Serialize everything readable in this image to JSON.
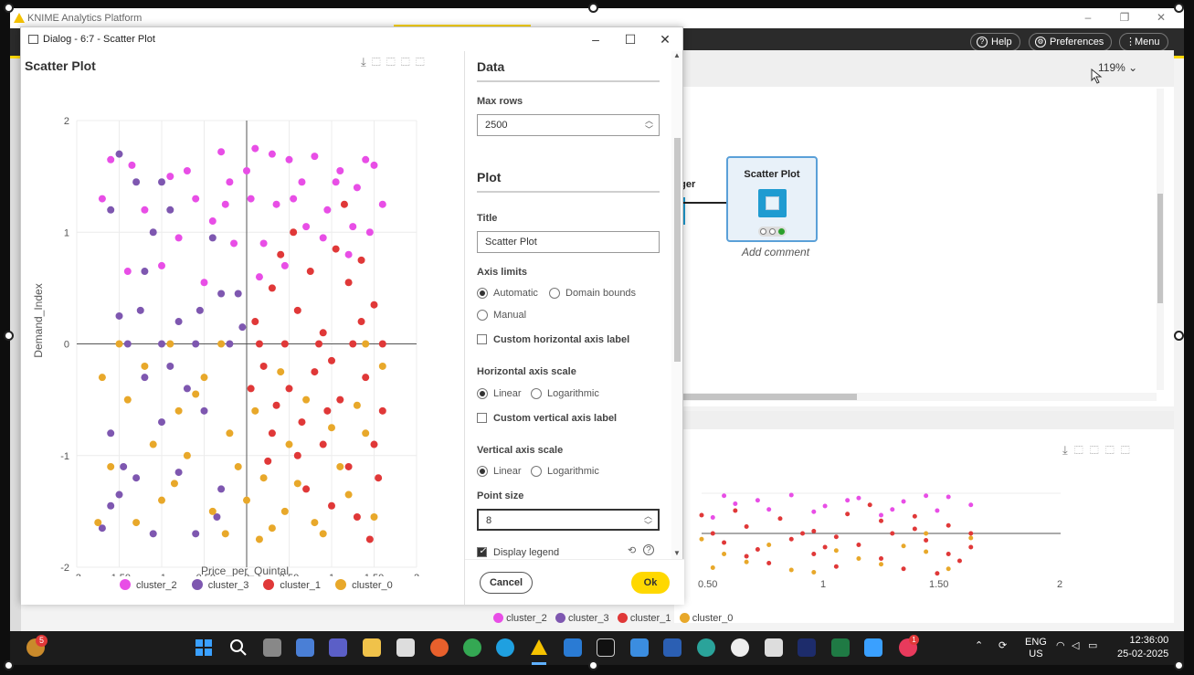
{
  "app": {
    "title": "KNIME Analytics Platform",
    "help": "Help",
    "preferences": "Preferences",
    "menu": "Menu",
    "zoom": "119%",
    "node_title": "Scatter Plot",
    "partial_node_label": "ager",
    "add_comment": "Add comment"
  },
  "dialog": {
    "title": "Dialog - 6:7 - Scatter Plot",
    "cancel": "Cancel",
    "ok": "Ok"
  },
  "settings": {
    "data_section": "Data",
    "max_rows_label": "Max rows",
    "max_rows_value": "2500",
    "plot_section": "Plot",
    "title_label": "Title",
    "title_value": "Scatter Plot",
    "axis_limits_label": "Axis limits",
    "axis_automatic": "Automatic",
    "axis_domain": "Domain bounds",
    "axis_manual": "Manual",
    "custom_h_label": "Custom horizontal axis label",
    "h_scale_label": "Horizontal axis scale",
    "linear": "Linear",
    "logarithmic": "Logarithmic",
    "custom_v_label": "Custom vertical axis label",
    "v_scale_label": "Vertical axis scale",
    "point_size_label": "Point size",
    "point_size_value": "8",
    "display_legend": "Display legend"
  },
  "taskbar": {
    "badge_count": "5",
    "notif_count": "1",
    "lang1": "ENG",
    "lang2": "US",
    "time": "12:36:00",
    "date": "25-02-2025"
  },
  "chart_data": {
    "type": "scatter",
    "title": "Scatter Plot",
    "xlabel": "Price_per_Quintal",
    "ylabel": "Demand_Index",
    "xlim": [
      -2,
      2
    ],
    "ylim": [
      -2,
      2
    ],
    "x_ticks": [
      "-2",
      "-1.50",
      "-1",
      "-0.50",
      "0",
      "0.50",
      "1",
      "1.50",
      "2"
    ],
    "y_ticks": [
      "2",
      "1",
      "0",
      "-1",
      "-2"
    ],
    "grid": true,
    "legend": "bottom",
    "series": [
      {
        "name": "cluster_2",
        "color": "#e84ee6",
        "points": [
          [
            0.1,
            1.75
          ],
          [
            0.3,
            1.7
          ],
          [
            -0.3,
            1.72
          ],
          [
            0.55,
            1.3
          ],
          [
            0.8,
            1.68
          ],
          [
            1.1,
            1.55
          ],
          [
            1.5,
            1.6
          ],
          [
            -0.6,
            1.3
          ],
          [
            -0.2,
            1.45
          ],
          [
            0.35,
            1.25
          ],
          [
            0.95,
            1.2
          ],
          [
            1.3,
            1.4
          ],
          [
            -0.4,
            1.1
          ],
          [
            0.0,
            1.55
          ],
          [
            0.65,
            1.45
          ],
          [
            1.45,
            1.0
          ],
          [
            0.2,
            0.9
          ],
          [
            -0.8,
            0.95
          ],
          [
            0.45,
            0.7
          ],
          [
            1.2,
            0.8
          ],
          [
            -0.9,
            1.5
          ],
          [
            -1.2,
            1.2
          ],
          [
            -1.4,
            0.65
          ],
          [
            -1.6,
            1.65
          ],
          [
            -1.7,
            1.3
          ],
          [
            -1.0,
            0.7
          ],
          [
            -0.5,
            0.55
          ],
          [
            0.15,
            0.6
          ],
          [
            1.6,
            1.25
          ],
          [
            0.7,
            1.05
          ],
          [
            -0.15,
            0.9
          ],
          [
            1.05,
            1.45
          ],
          [
            1.4,
            1.65
          ],
          [
            0.5,
            1.65
          ],
          [
            -0.7,
            1.55
          ],
          [
            0.9,
            0.95
          ],
          [
            -1.35,
            1.6
          ],
          [
            0.05,
            1.3
          ],
          [
            1.25,
            1.05
          ],
          [
            -0.25,
            1.25
          ]
        ]
      },
      {
        "name": "cluster_3",
        "color": "#7e57b0",
        "points": [
          [
            -1.5,
            1.7
          ],
          [
            -1.3,
            1.45
          ],
          [
            -0.9,
            1.2
          ],
          [
            -1.6,
            1.2
          ],
          [
            -1.1,
            1.0
          ],
          [
            -0.4,
            0.95
          ],
          [
            -0.3,
            0.45
          ],
          [
            -1.2,
            0.65
          ],
          [
            -1.5,
            0.25
          ],
          [
            -0.8,
            0.2
          ],
          [
            -1.4,
            0.0
          ],
          [
            -1.0,
            0.0
          ],
          [
            -0.6,
            0.0
          ],
          [
            -0.2,
            0.0
          ],
          [
            -1.2,
            -0.3
          ],
          [
            -0.7,
            -0.4
          ],
          [
            -1.0,
            -0.7
          ],
          [
            -1.6,
            -0.8
          ],
          [
            -0.5,
            -0.6
          ],
          [
            -1.3,
            -1.2
          ],
          [
            -0.3,
            -1.3
          ],
          [
            -1.5,
            -1.35
          ],
          [
            -0.8,
            -1.15
          ],
          [
            -1.7,
            -1.65
          ],
          [
            -1.1,
            -1.7
          ],
          [
            -0.6,
            -1.7
          ],
          [
            -1.45,
            -1.1
          ],
          [
            -0.1,
            0.45
          ],
          [
            -0.9,
            -0.2
          ],
          [
            -1.0,
            1.45
          ],
          [
            -0.35,
            -1.55
          ],
          [
            -1.6,
            -1.45
          ],
          [
            -0.05,
            0.15
          ],
          [
            -1.25,
            0.3
          ],
          [
            -0.55,
            0.3
          ]
        ]
      },
      {
        "name": "cluster_1",
        "color": "#e03838",
        "points": [
          [
            0.1,
            0.2
          ],
          [
            0.3,
            0.5
          ],
          [
            0.6,
            0.3
          ],
          [
            0.9,
            0.1
          ],
          [
            1.2,
            0.55
          ],
          [
            1.5,
            0.35
          ],
          [
            0.2,
            -0.2
          ],
          [
            0.5,
            -0.4
          ],
          [
            0.8,
            -0.25
          ],
          [
            1.1,
            -0.5
          ],
          [
            1.4,
            -0.3
          ],
          [
            1.6,
            -0.6
          ],
          [
            0.3,
            -0.8
          ],
          [
            0.6,
            -1.0
          ],
          [
            0.9,
            -0.9
          ],
          [
            1.2,
            -1.1
          ],
          [
            1.5,
            -0.9
          ],
          [
            0.7,
            -1.3
          ],
          [
            1.0,
            -1.45
          ],
          [
            1.3,
            -1.55
          ],
          [
            1.55,
            -1.2
          ],
          [
            0.4,
            0.8
          ],
          [
            0.75,
            0.65
          ],
          [
            1.05,
            0.85
          ],
          [
            1.35,
            0.75
          ],
          [
            0.15,
            0.0
          ],
          [
            0.45,
            0.0
          ],
          [
            0.85,
            0.0
          ],
          [
            1.25,
            0.0
          ],
          [
            1.6,
            0.0
          ],
          [
            0.35,
            -0.55
          ],
          [
            0.95,
            -0.6
          ],
          [
            1.45,
            -1.75
          ],
          [
            0.55,
            1.0
          ],
          [
            1.15,
            1.25
          ],
          [
            0.25,
            -1.05
          ],
          [
            1.0,
            -0.15
          ],
          [
            0.65,
            -0.7
          ],
          [
            1.35,
            0.2
          ],
          [
            0.05,
            -0.4
          ]
        ]
      },
      {
        "name": "cluster_0",
        "color": "#e8a82a",
        "points": [
          [
            -1.7,
            -0.3
          ],
          [
            -1.4,
            -0.5
          ],
          [
            -1.1,
            -0.9
          ],
          [
            -0.8,
            -0.6
          ],
          [
            -0.5,
            -0.3
          ],
          [
            -0.2,
            -0.8
          ],
          [
            0.0,
            -1.4
          ],
          [
            0.2,
            -1.2
          ],
          [
            0.5,
            -0.9
          ],
          [
            0.8,
            -1.6
          ],
          [
            1.1,
            -1.1
          ],
          [
            1.4,
            -0.8
          ],
          [
            -1.6,
            -1.1
          ],
          [
            -1.3,
            -1.6
          ],
          [
            -1.0,
            -1.4
          ],
          [
            -0.7,
            -1.0
          ],
          [
            -0.4,
            -1.5
          ],
          [
            -0.1,
            -1.1
          ],
          [
            0.3,
            -1.65
          ],
          [
            0.6,
            -1.25
          ],
          [
            0.9,
            -1.7
          ],
          [
            1.2,
            -1.35
          ],
          [
            1.5,
            -1.55
          ],
          [
            -1.5,
            0.0
          ],
          [
            -0.9,
            0.0
          ],
          [
            -0.3,
            0.0
          ],
          [
            1.4,
            0.0
          ],
          [
            -1.2,
            -0.2
          ],
          [
            -0.6,
            -0.45
          ],
          [
            0.1,
            -0.6
          ],
          [
            0.4,
            -0.25
          ],
          [
            0.7,
            -0.5
          ],
          [
            1.0,
            -0.75
          ],
          [
            1.3,
            -0.55
          ],
          [
            -1.75,
            -1.6
          ],
          [
            -0.25,
            -1.7
          ],
          [
            0.15,
            -1.75
          ],
          [
            1.6,
            -0.2
          ],
          [
            -0.85,
            -1.25
          ],
          [
            0.45,
            -1.5
          ]
        ]
      }
    ]
  }
}
